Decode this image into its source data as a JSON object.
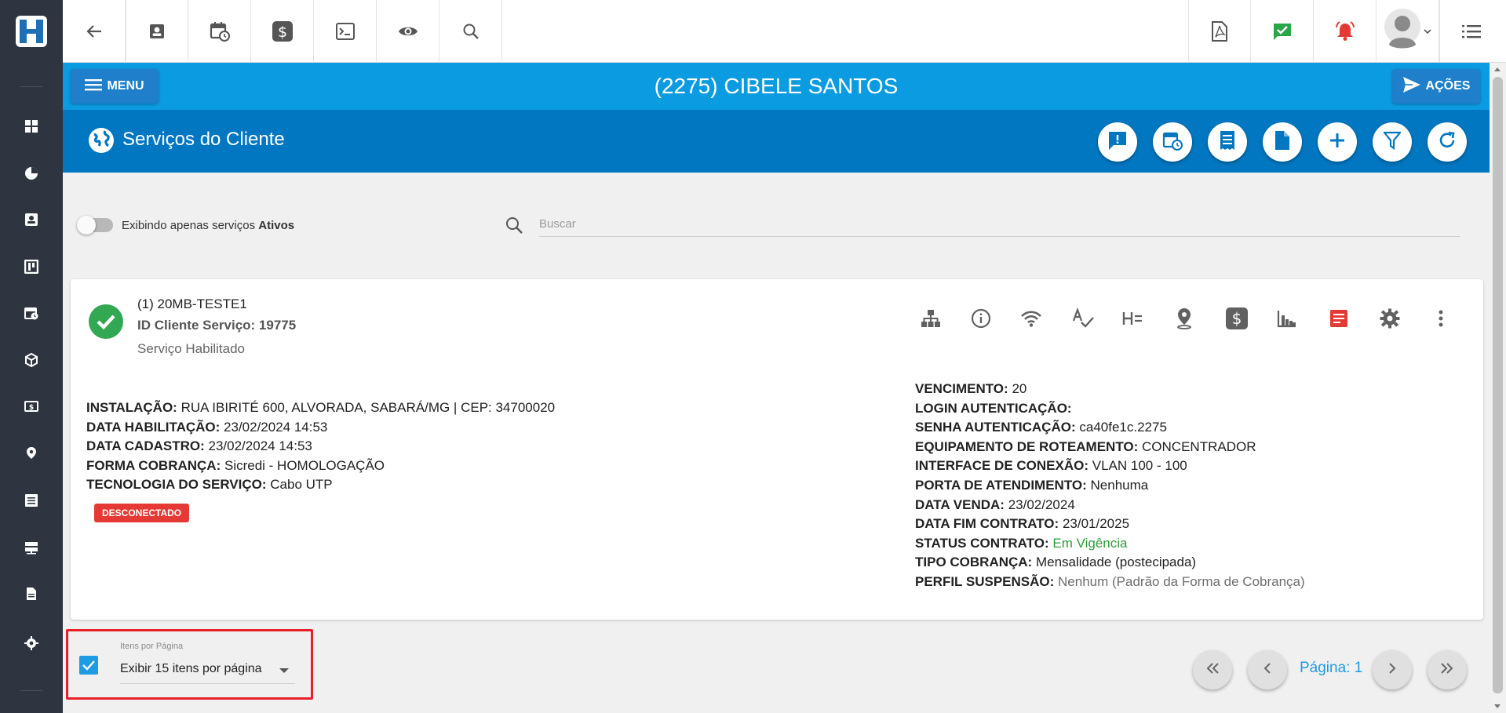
{
  "header": {
    "menu_label": "MENU",
    "client_name": "(2275) CIBELE SANTOS",
    "actions_label": "AÇÕES",
    "section_title": "Serviços do Cliente"
  },
  "filters": {
    "toggle_text": "Exibindo apenas serviços ",
    "toggle_bold": "Ativos",
    "search_placeholder": "Buscar"
  },
  "service": {
    "title": "(1) 20MB-TESTE1",
    "id_line": "ID Cliente Serviço: 19775",
    "status_text": "Serviço Habilitado",
    "badge": "DESCONECTADO",
    "left_fields": [
      {
        "label": "INSTALAÇÃO:",
        "value": "RUA IBIRITÉ 600, ALVORADA, SABARÁ/MG | CEP: 34700020"
      },
      {
        "label": "DATA HABILITAÇÃO:",
        "value": "23/02/2024 14:53"
      },
      {
        "label": "DATA CADASTRO:",
        "value": "23/02/2024 14:53"
      },
      {
        "label": "FORMA COBRANÇA:",
        "value": "Sicredi - HOMOLOGAÇÃO"
      },
      {
        "label": "TECNOLOGIA DO SERVIÇO:",
        "value": "Cabo UTP"
      }
    ],
    "right_fields": [
      {
        "label": "VENCIMENTO:",
        "value": "20"
      },
      {
        "label": "LOGIN AUTENTICAÇÃO:",
        "value": ""
      },
      {
        "label": "SENHA AUTENTICAÇÃO:",
        "value": "ca40fe1c.2275"
      },
      {
        "label": "EQUIPAMENTO DE ROTEAMENTO:",
        "value": "CONCENTRADOR"
      },
      {
        "label": "INTERFACE DE CONEXÃO:",
        "value": "VLAN 100 - 100"
      },
      {
        "label": "PORTA DE ATENDIMENTO:",
        "value": "Nenhuma"
      },
      {
        "label": "DATA VENDA:",
        "value": "23/02/2024"
      },
      {
        "label": "DATA FIM CONTRATO:",
        "value": "23/01/2025"
      },
      {
        "label": "STATUS CONTRATO:",
        "value": "Em Vigência"
      },
      {
        "label": "TIPO COBRANÇA:",
        "value": "Mensalidade (postecipada)"
      },
      {
        "label": "PERFIL SUSPENSÃO:",
        "value": "Nenhum (Padrão da Forma de Cobrança)"
      }
    ]
  },
  "footer": {
    "items_per_page_label": "Itens por Página",
    "items_per_page_value": "Exibir 15 itens por página",
    "page_label": "Página: 1"
  },
  "colors": {
    "sidebar": "#2e3440",
    "header_blue": "#0b9be0",
    "section_blue": "#0277c1",
    "success_green": "#33a852",
    "danger_red": "#e53935",
    "accent": "#1e9be3"
  },
  "icons": {
    "sidebar": [
      "dashboard-icon",
      "pie-chart-icon",
      "contact-card-icon",
      "board-icon",
      "calendar-clock-icon",
      "package-icon",
      "money-icon",
      "location-icon",
      "list-icon",
      "server-icon",
      "document-icon",
      "settings-icon"
    ],
    "topbar": [
      "back-arrow-icon",
      "contact-card-icon",
      "calendar-clock-icon",
      "dollar-icon",
      "terminal-icon",
      "eye-icon",
      "search-icon",
      "pdf-icon",
      "chat-check-icon",
      "alarm-bell-icon",
      "avatar",
      "list-icon"
    ],
    "section_actions": [
      "alert-message-icon",
      "calendar-clock-icon",
      "receipt-icon",
      "file-icon",
      "add-icon",
      "filter-icon",
      "refresh-icon"
    ],
    "card_actions": [
      "network-tree-icon",
      "info-icon",
      "wifi-icon",
      "spellcheck-icon",
      "heading-icon",
      "location-icon",
      "dollar-icon",
      "bar-chart-icon",
      "red-document-icon",
      "settings-icon",
      "more-vertical-icon"
    ]
  }
}
